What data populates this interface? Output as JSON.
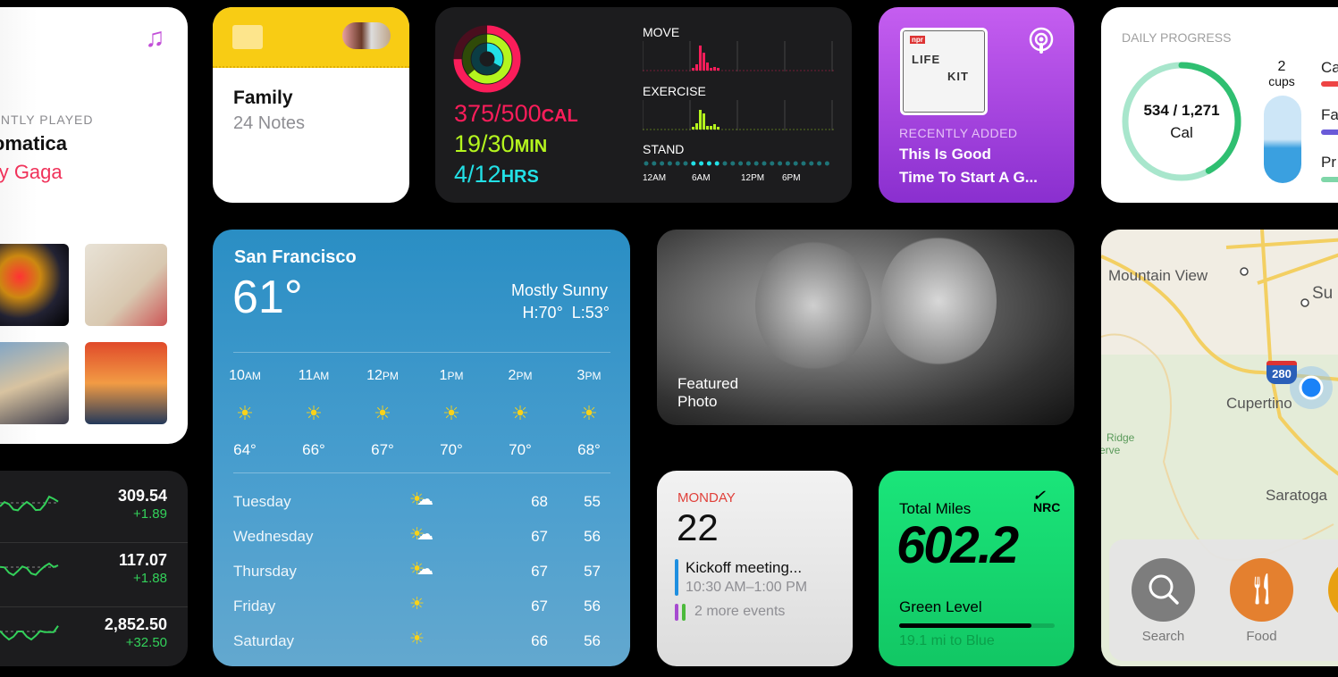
{
  "music": {
    "section": "RECENTLY PLAYED",
    "album": "Chromatica",
    "artist": "Lady Gaga",
    "icon": "music-note-icon"
  },
  "notes": {
    "folder": "Family",
    "count": "24 Notes",
    "icon": "shared-folder-icon"
  },
  "activity": {
    "move": "375/500",
    "move_unit": "CAL",
    "exercise": "19/30",
    "exercise_unit": "MIN",
    "stand": "4/12",
    "stand_unit": "HRS",
    "labels": {
      "move": "MOVE",
      "exercise": "EXERCISE",
      "stand": "STAND"
    },
    "axis": [
      "12AM",
      "6AM",
      "12PM",
      "6PM"
    ],
    "colors": {
      "move": "#fa1d5a",
      "exercise": "#b4f51e",
      "stand": "#22e0e6"
    }
  },
  "podcast": {
    "section": "RECENTLY ADDED",
    "title_line1": "This Is Good",
    "title_line2": "Time To Start A G...",
    "cover_text": {
      "brand": "npr",
      "word1": "LIFE",
      "word2": "KIT"
    },
    "icon": "podcasts-icon"
  },
  "daily": {
    "title": "DAILY PROGRESS",
    "calories": "534 / 1,271",
    "cal_unit": "Cal",
    "cal_progress": 0.42,
    "water": "2",
    "water_unit": "cups",
    "macros": [
      "Ca",
      "Fa",
      "Pr"
    ]
  },
  "weather": {
    "city": "San Francisco",
    "temp": "61°",
    "condition": "Mostly Sunny",
    "high_low": "H:70°  L:53°",
    "hourly": [
      {
        "h": "10",
        "p": "AM",
        "t": "64°"
      },
      {
        "h": "11",
        "p": "AM",
        "t": "66°"
      },
      {
        "h": "12",
        "p": "PM",
        "t": "67°"
      },
      {
        "h": "1",
        "p": "PM",
        "t": "70°"
      },
      {
        "h": "2",
        "p": "PM",
        "t": "70°"
      },
      {
        "h": "3",
        "p": "PM",
        "t": "68°"
      }
    ],
    "daily": [
      {
        "d": "Tuesday",
        "hi": "68",
        "lo": "55",
        "icon": "partly-cloudy"
      },
      {
        "d": "Wednesday",
        "hi": "67",
        "lo": "56",
        "icon": "partly-cloudy"
      },
      {
        "d": "Thursday",
        "hi": "67",
        "lo": "57",
        "icon": "partly-cloudy"
      },
      {
        "d": "Friday",
        "hi": "67",
        "lo": "56",
        "icon": "sun"
      },
      {
        "d": "Saturday",
        "hi": "66",
        "lo": "56",
        "icon": "sun"
      }
    ]
  },
  "photo": {
    "label_line1": "Featured",
    "label_line2": "Photo"
  },
  "calendar": {
    "weekday": "MONDAY",
    "date": "22",
    "event": "Kickoff meeting...",
    "time": "10:30 AM–1:00 PM",
    "more": "2 more events"
  },
  "nrc": {
    "title": "Total Miles",
    "miles": "602.2",
    "brand": "NRC",
    "level": "Green Level",
    "progress": 0.85,
    "to_next": "19.1 mi to Blue"
  },
  "map": {
    "places": [
      "Mountain View",
      "Su",
      "Cupertino",
      "Ridge",
      "erve",
      "Saratoga"
    ],
    "highway": "280",
    "buttons": [
      {
        "label": "Search",
        "icon": "search-icon"
      },
      {
        "label": "Food",
        "icon": "fork-knife-icon"
      }
    ]
  },
  "stocks": [
    {
      "price": "309.54",
      "change": "+1.89"
    },
    {
      "price": "117.07",
      "change": "+1.88"
    },
    {
      "price": "2,852.50",
      "change": "+32.50"
    }
  ]
}
